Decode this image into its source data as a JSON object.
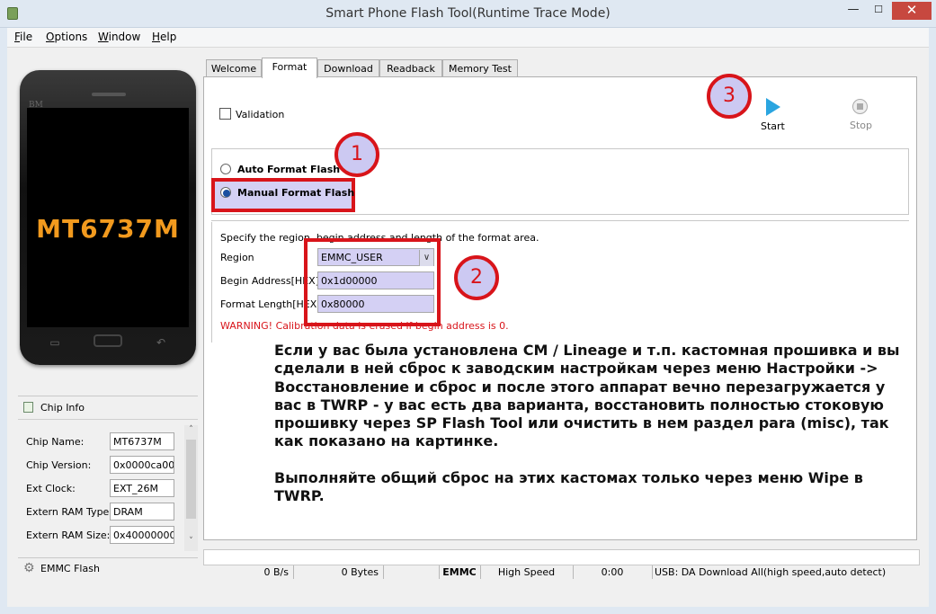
{
  "window": {
    "title": "Smart Phone Flash Tool(Runtime Trace Mode)",
    "min": "—",
    "max": "☐",
    "close": "✕"
  },
  "menu": [
    "File",
    "Options",
    "Window",
    "Help"
  ],
  "phone": {
    "brand": "BM",
    "chip_label": "MT6737M",
    "key_menu": "▭",
    "key_back": "↶"
  },
  "chip_info": {
    "title": "Chip Info",
    "rows": [
      {
        "label": "Chip Name:",
        "value": "MT6737M"
      },
      {
        "label": "Chip Version:",
        "value": "0x0000ca00"
      },
      {
        "label": "Ext Clock:",
        "value": "EXT_26M"
      },
      {
        "label": "Extern RAM Type:",
        "value": "DRAM"
      },
      {
        "label": "Extern RAM Size:",
        "value": "0x40000000"
      }
    ],
    "storage": "EMMC Flash"
  },
  "tabs": [
    "Welcome",
    "Format",
    "Download",
    "Readback",
    "Memory Test"
  ],
  "active_tab": "Format",
  "format": {
    "validation_label": "Validation",
    "start_label": "Start",
    "stop_label": "Stop",
    "auto_label": "Auto Format Flash",
    "manual_label": "Manual Format Flash",
    "selected_mode": "Manual Format Flash",
    "spec_text": "Specify the region, begin address and length of the format area.",
    "region_label": "Region",
    "region_value": "EMMC_USER",
    "begin_label": "Begin Address[HEX]:",
    "begin_value": "0x1d00000",
    "length_label": "Format Length[HEX]:",
    "length_value": "0x80000",
    "warning": "WARNING! Calibration data is erased if begin address is 0."
  },
  "badges": [
    "1",
    "2",
    "3"
  ],
  "note": {
    "paragraph1": "Если у вас была установлена CM / Lineage и т.п. кастомная прошивка и вы сделали в ней сброс к заводским настройкам через меню Настройки -> Восстановление и сброс и после этого аппарат вечно перезагружается у вас в TWRP - у вас есть два варианта, восстановить полностью стоковую прошивку через SP Flash Tool или очистить в нем раздел para (misc), так как показано на картинке.",
    "paragraph2": "Выполняйте общий сброс на этих кастомах только через меню Wipe в TWRP."
  },
  "status": {
    "speed": "0 B/s",
    "bytes": "0 Bytes",
    "storage": "EMMC",
    "mode": "High Speed",
    "time": "0:00",
    "usb": "USB: DA Download All(high speed,auto detect)"
  },
  "colors": {
    "accent_red": "#d8141a",
    "highlight": "#d4d0f4",
    "chip_orange": "#f29a1e",
    "start_blue": "#2aa5e0"
  }
}
